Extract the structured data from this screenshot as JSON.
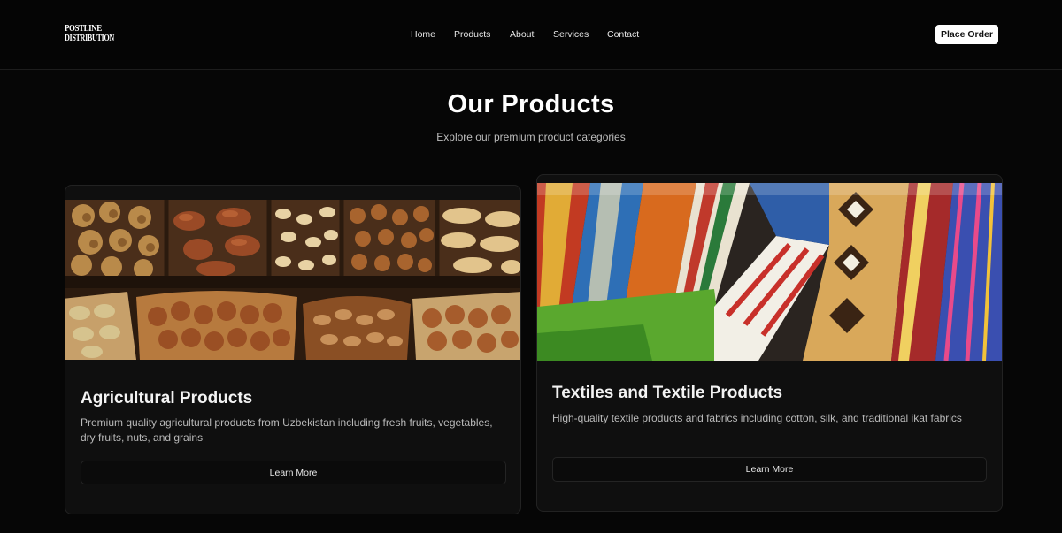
{
  "brand": {
    "line1": "POSTLINE",
    "line2": "DISTRIBUTION"
  },
  "nav": {
    "items": [
      {
        "label": "Home"
      },
      {
        "label": "Products"
      },
      {
        "label": "About"
      },
      {
        "label": "Services"
      },
      {
        "label": "Contact"
      }
    ],
    "cta_label": "Place Order"
  },
  "hero": {
    "title": "Our Products",
    "subtitle": "Explore our premium product categories"
  },
  "products": [
    {
      "title": "Agricultural Products",
      "description": "Premium quality agricultural products from Uzbekistan including fresh fruits, vegetables, dry fruits, nuts, and grains",
      "button_label": "Learn More",
      "image": "nuts-in-trays"
    },
    {
      "title": "Textiles and Textile Products",
      "description": "High-quality textile products and fabrics including cotton, silk, and traditional ikat fabrics",
      "button_label": "Learn More",
      "image": "colorful-woven-fabrics"
    }
  ]
}
